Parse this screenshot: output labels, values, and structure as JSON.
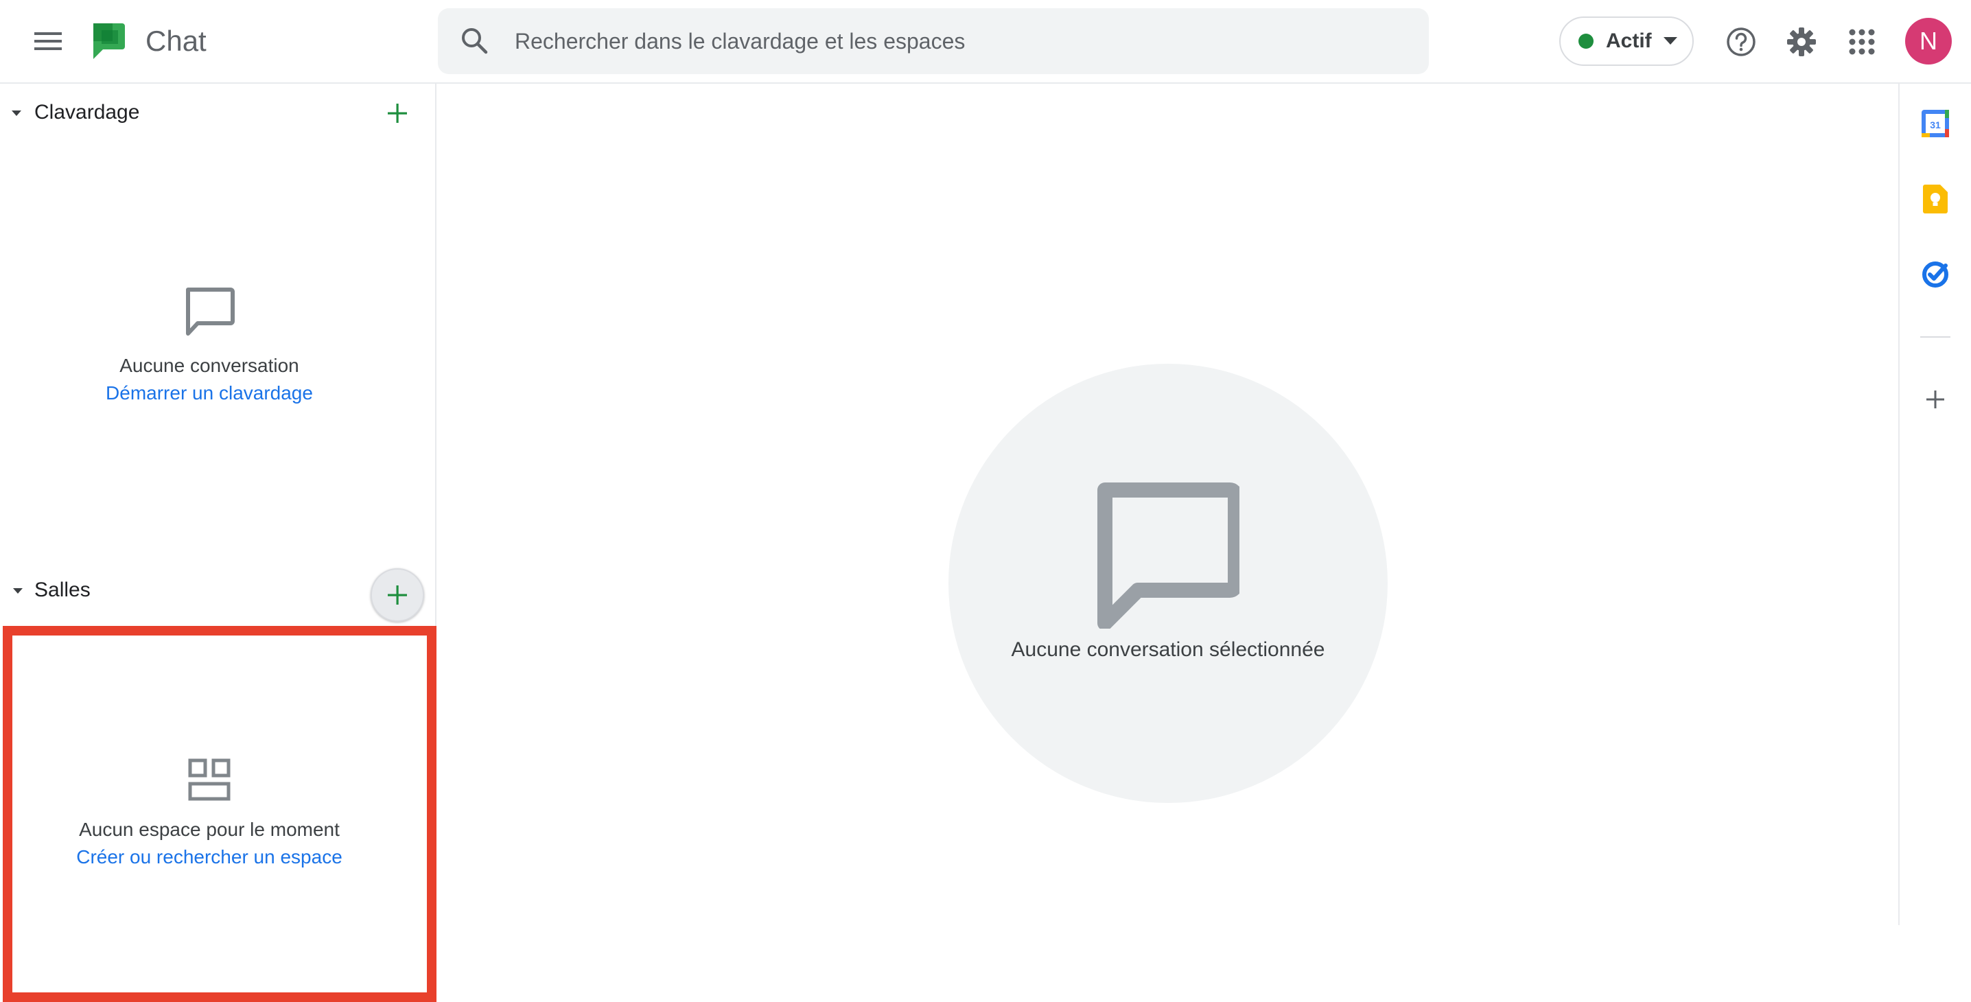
{
  "header": {
    "app_title": "Chat",
    "search_placeholder": "Rechercher dans le clavardage et les espaces",
    "status_label": "Actif",
    "status_color": "#1e8e3e",
    "avatar_initial": "N",
    "avatar_color": "#d63a73",
    "icons": [
      "menu-icon",
      "chat-logo",
      "search-icon",
      "help-icon",
      "gear-icon",
      "apps-grid-icon"
    ]
  },
  "sidebar": {
    "chats": {
      "title": "Clavardage",
      "empty_text": "Aucune conversation",
      "empty_link": "Démarrer un clavardage"
    },
    "rooms": {
      "title": "Salles",
      "empty_text": "Aucun espace pour le moment",
      "empty_link": "Créer ou rechercher un espace"
    }
  },
  "main": {
    "empty_text": "Aucune conversation sélectionnée"
  },
  "right_rail": {
    "calendar_day": "31",
    "icons": [
      "calendar-icon",
      "keep-icon",
      "tasks-icon",
      "add-addon-icon"
    ]
  },
  "colors": {
    "accent_green": "#1e8e3e",
    "link_blue": "#1a73e8",
    "highlight_red": "#e8402c"
  }
}
